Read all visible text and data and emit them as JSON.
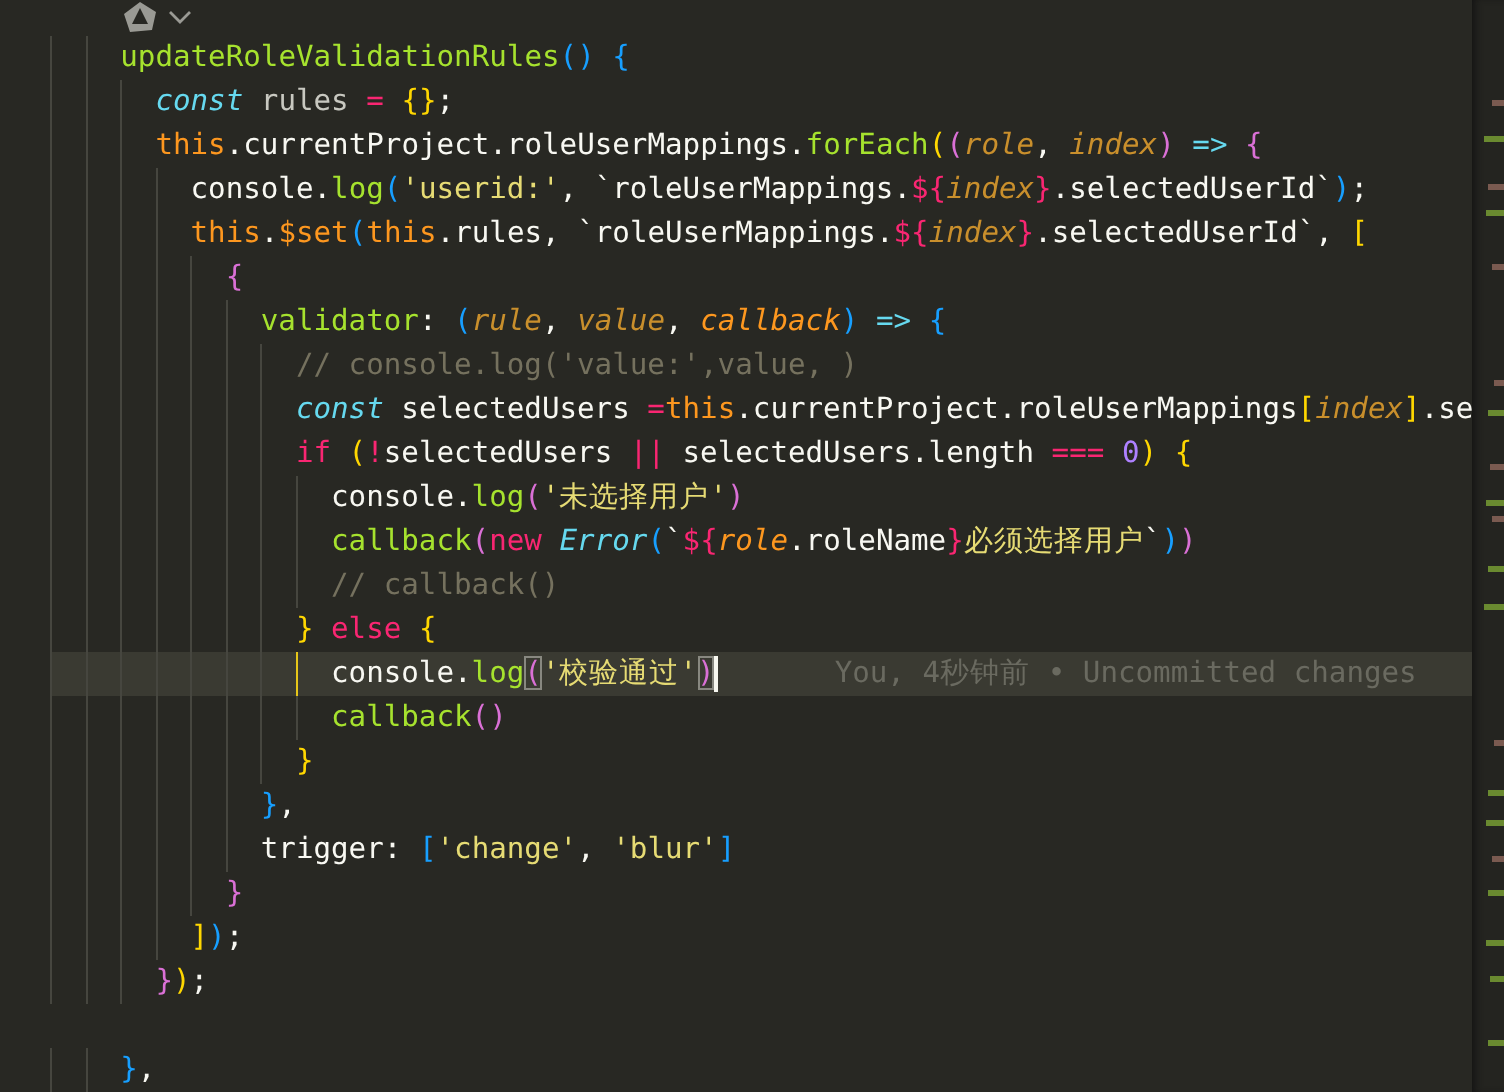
{
  "editor": {
    "lines": [
      {
        "current": false,
        "tokens": [
          {
            "kind": "fn",
            "text": "    updateRoleValidationRules"
          },
          {
            "kind": "b3",
            "text": "() "
          },
          {
            "kind": "b3",
            "text": "{"
          }
        ]
      },
      {
        "current": false,
        "tokens": [
          {
            "kind": "kw",
            "text": "      const"
          },
          {
            "kind": "var",
            "text": " rules "
          },
          {
            "kind": "op",
            "text": "= "
          },
          {
            "kind": "b1",
            "text": "{}"
          },
          {
            "kind": "plain",
            "text": ";"
          }
        ]
      },
      {
        "current": false,
        "tokens": [
          {
            "kind": "this",
            "text": "      this"
          },
          {
            "kind": "plain",
            "text": ".currentProject.roleUserMappings."
          },
          {
            "kind": "fn",
            "text": "forEach"
          },
          {
            "kind": "b1",
            "text": "("
          },
          {
            "kind": "b2",
            "text": "("
          },
          {
            "kind": "param",
            "text": "role"
          },
          {
            "kind": "plain",
            "text": ", "
          },
          {
            "kind": "param",
            "text": "index"
          },
          {
            "kind": "b2",
            "text": ") "
          },
          {
            "kind": "arrow",
            "text": "=> "
          },
          {
            "kind": "b2",
            "text": "{"
          }
        ]
      },
      {
        "current": false,
        "tokens": [
          {
            "kind": "plain",
            "text": "        console."
          },
          {
            "kind": "fn",
            "text": "log"
          },
          {
            "kind": "b3",
            "text": "("
          },
          {
            "kind": "str",
            "text": "'userid:'"
          },
          {
            "kind": "plain",
            "text": ", `roleUserMappings."
          },
          {
            "kind": "tpl",
            "text": "${"
          },
          {
            "kind": "param",
            "text": "index"
          },
          {
            "kind": "tpl",
            "text": "}"
          },
          {
            "kind": "plain",
            "text": ".selectedUserId`"
          },
          {
            "kind": "b3",
            "text": ")"
          },
          {
            "kind": "plain",
            "text": ";"
          }
        ]
      },
      {
        "current": false,
        "tokens": [
          {
            "kind": "this",
            "text": "        this"
          },
          {
            "kind": "plain",
            "text": "."
          },
          {
            "kind": "this",
            "text": "$set"
          },
          {
            "kind": "b3",
            "text": "("
          },
          {
            "kind": "this",
            "text": "this"
          },
          {
            "kind": "plain",
            "text": ".rules, `roleUserMappings."
          },
          {
            "kind": "tpl",
            "text": "${"
          },
          {
            "kind": "param",
            "text": "index"
          },
          {
            "kind": "tpl",
            "text": "}"
          },
          {
            "kind": "plain",
            "text": ".selectedUserId`, "
          },
          {
            "kind": "b1",
            "text": "["
          }
        ]
      },
      {
        "current": false,
        "tokens": [
          {
            "kind": "b2",
            "text": "          {"
          }
        ]
      },
      {
        "current": false,
        "tokens": [
          {
            "kind": "fn",
            "text": "            validator"
          },
          {
            "kind": "plain",
            "text": ": "
          },
          {
            "kind": "b3",
            "text": "("
          },
          {
            "kind": "param",
            "text": "rule"
          },
          {
            "kind": "plain",
            "text": ", "
          },
          {
            "kind": "param",
            "text": "value"
          },
          {
            "kind": "plain",
            "text": ", "
          },
          {
            "kind": "param2",
            "text": "callback"
          },
          {
            "kind": "b3",
            "text": ") "
          },
          {
            "kind": "arrow",
            "text": "=> "
          },
          {
            "kind": "b3",
            "text": "{"
          }
        ]
      },
      {
        "current": false,
        "tokens": [
          {
            "kind": "comment",
            "text": "              // console.log('value:',value, )"
          }
        ]
      },
      {
        "current": false,
        "tokens": [
          {
            "kind": "kw",
            "text": "              const"
          },
          {
            "kind": "plain",
            "text": " selectedUsers "
          },
          {
            "kind": "op",
            "text": "="
          },
          {
            "kind": "this",
            "text": "this"
          },
          {
            "kind": "plain",
            "text": ".currentProject.roleUserMappings"
          },
          {
            "kind": "b1",
            "text": "["
          },
          {
            "kind": "param",
            "text": "index"
          },
          {
            "kind": "b1",
            "text": "]"
          },
          {
            "kind": "plain",
            "text": ".se"
          }
        ]
      },
      {
        "current": false,
        "tokens": [
          {
            "kind": "op",
            "text": "              if "
          },
          {
            "kind": "b1",
            "text": "("
          },
          {
            "kind": "op",
            "text": "!"
          },
          {
            "kind": "plain",
            "text": "selectedUsers "
          },
          {
            "kind": "op",
            "text": "||"
          },
          {
            "kind": "plain",
            "text": " selectedUsers.length "
          },
          {
            "kind": "op",
            "text": "=== "
          },
          {
            "kind": "num",
            "text": "0"
          },
          {
            "kind": "b1",
            "text": ") "
          },
          {
            "kind": "b1",
            "text": "{"
          }
        ]
      },
      {
        "current": false,
        "tokens": [
          {
            "kind": "plain",
            "text": "                console."
          },
          {
            "kind": "fn",
            "text": "log"
          },
          {
            "kind": "b2",
            "text": "("
          },
          {
            "kind": "str",
            "text": "'未选择用户'"
          },
          {
            "kind": "b2",
            "text": ")"
          }
        ]
      },
      {
        "current": false,
        "tokens": [
          {
            "kind": "fn",
            "text": "                callback"
          },
          {
            "kind": "b2",
            "text": "("
          },
          {
            "kind": "op",
            "text": "new "
          },
          {
            "kind": "kw",
            "text": "Error"
          },
          {
            "kind": "b3",
            "text": "("
          },
          {
            "kind": "plain",
            "text": "`"
          },
          {
            "kind": "tpl",
            "text": "${"
          },
          {
            "kind": "param2",
            "text": "role"
          },
          {
            "kind": "plain",
            "text": ".roleName"
          },
          {
            "kind": "tpl",
            "text": "}"
          },
          {
            "kind": "str",
            "text": "必须选择用户"
          },
          {
            "kind": "plain",
            "text": "`"
          },
          {
            "kind": "b3",
            "text": ")"
          },
          {
            "kind": "b2",
            "text": ")"
          }
        ]
      },
      {
        "current": false,
        "tokens": [
          {
            "kind": "comment",
            "text": "                // callback()"
          }
        ]
      },
      {
        "current": false,
        "tokens": [
          {
            "kind": "b1",
            "text": "              } "
          },
          {
            "kind": "op",
            "text": "else "
          },
          {
            "kind": "b1",
            "text": "{"
          }
        ]
      },
      {
        "current": true,
        "blame": "You, 4秒钟前 • Uncommitted changes",
        "tokens": [
          {
            "kind": "plain",
            "text": "                console."
          },
          {
            "kind": "fn",
            "text": "log"
          },
          {
            "kind": "b2",
            "text": "(",
            "boxed": true
          },
          {
            "kind": "str",
            "text": "'校验通过'"
          },
          {
            "kind": "b2",
            "text": ")",
            "boxed": true
          }
        ]
      },
      {
        "current": false,
        "tokens": [
          {
            "kind": "fn",
            "text": "                callback"
          },
          {
            "kind": "b2",
            "text": "()"
          }
        ]
      },
      {
        "current": false,
        "tokens": [
          {
            "kind": "b1",
            "text": "              }"
          }
        ]
      },
      {
        "current": false,
        "tokens": [
          {
            "kind": "b3",
            "text": "            }"
          },
          {
            "kind": "plain",
            "text": ","
          }
        ]
      },
      {
        "current": false,
        "tokens": [
          {
            "kind": "plain",
            "text": "            trigger: "
          },
          {
            "kind": "b3",
            "text": "["
          },
          {
            "kind": "str",
            "text": "'change'"
          },
          {
            "kind": "plain",
            "text": ", "
          },
          {
            "kind": "str",
            "text": "'blur'"
          },
          {
            "kind": "b3",
            "text": "]"
          }
        ]
      },
      {
        "current": false,
        "tokens": [
          {
            "kind": "b2",
            "text": "          }"
          }
        ]
      },
      {
        "current": false,
        "tokens": [
          {
            "kind": "b1",
            "text": "        ]"
          },
          {
            "kind": "b3",
            "text": ")"
          },
          {
            "kind": "plain",
            "text": ";"
          }
        ]
      },
      {
        "current": false,
        "tokens": [
          {
            "kind": "b2",
            "text": "      }"
          },
          {
            "kind": "b1",
            "text": ")"
          },
          {
            "kind": "plain",
            "text": ";"
          }
        ]
      },
      {
        "current": false
      },
      {
        "current": false,
        "tokens": [
          {
            "kind": "b3",
            "text": "    }"
          },
          {
            "kind": "plain",
            "text": ","
          }
        ]
      }
    ]
  }
}
